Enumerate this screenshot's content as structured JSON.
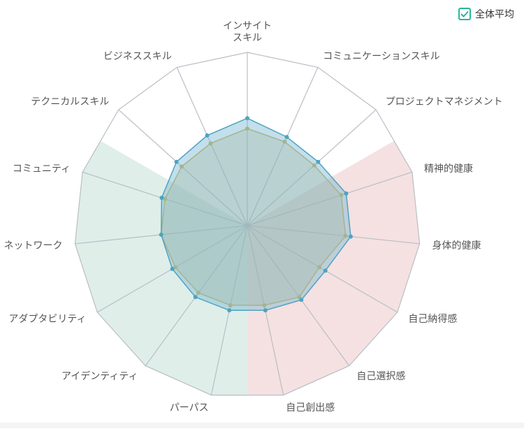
{
  "legend": {
    "label": "全体平均",
    "checked": true
  },
  "chart_data": {
    "type": "radar",
    "axes": [
      [
        "インサイト",
        "スキル"
      ],
      [
        "コミュニケーションスキル"
      ],
      [
        "プロジェクトマネジメント"
      ],
      [
        "精神的健康"
      ],
      [
        "身体的健康"
      ],
      [
        "自己納得感"
      ],
      [
        "自己選択感"
      ],
      [
        "自己創出感"
      ],
      [
        "パーパス"
      ],
      [
        "アイデンティティ"
      ],
      [
        "アダプタビリティ"
      ],
      [
        "ネットワーク"
      ],
      [
        "コミュニティ"
      ],
      [
        "テクニカルスキル"
      ],
      [
        "ビジネススキル"
      ]
    ],
    "range": [
      0,
      100
    ],
    "grid_levels": 1,
    "sectors": [
      {
        "axes_from": 13,
        "axes_to": 2,
        "color": "#e8e8e8"
      },
      {
        "axes_from": 3,
        "axes_to": 7,
        "color": "#f5e1e1"
      },
      {
        "axes_from": 8,
        "axes_to": 12,
        "color": "#dfeee9"
      }
    ],
    "series": [
      {
        "values": [
          62,
          56,
          55,
          60,
          60,
          52,
          53,
          50,
          50,
          51,
          50,
          50,
          52,
          55,
          57
        ],
        "color": "#4fa3c1",
        "fill": "rgba(120,185,210,0.45)"
      },
      {
        "name": "全体平均",
        "values": [
          56,
          53,
          52,
          57,
          57,
          48,
          51,
          47,
          47,
          48,
          48,
          50,
          50,
          51,
          52
        ],
        "color": "#c9b15a",
        "fill": "rgba(205,180,120,0.35)"
      }
    ]
  }
}
